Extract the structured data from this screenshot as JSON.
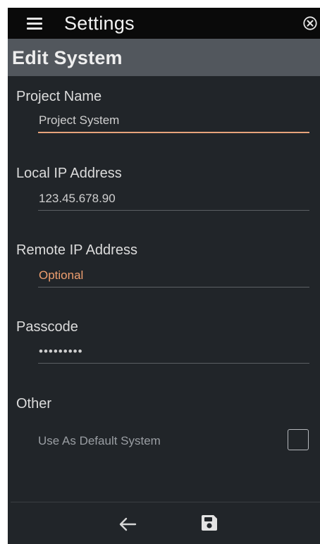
{
  "header": {
    "title": "Settings",
    "menu_icon": "hamburger-menu-icon",
    "close_icon": "circle-close-icon"
  },
  "page": {
    "title": "Edit System"
  },
  "form": {
    "project_name": {
      "label": "Project Name",
      "value": "Project System"
    },
    "local_ip": {
      "label": "Local IP Address",
      "value": "123.45.678.90"
    },
    "remote_ip": {
      "label": "Remote IP Address",
      "placeholder": "Optional",
      "value": ""
    },
    "passcode": {
      "label": "Passcode",
      "value": "•••••••••"
    },
    "other": {
      "label": "Other",
      "default_system_label": "Use As Default System",
      "default_system_checked": false
    }
  },
  "footer": {
    "back_icon": "arrow-left-icon",
    "save_icon": "floppy-save-icon"
  },
  "colors": {
    "background": "#212529",
    "topbar": "#0a0a0a",
    "subheader": "#52575d",
    "accent": "#ef9f6f"
  }
}
